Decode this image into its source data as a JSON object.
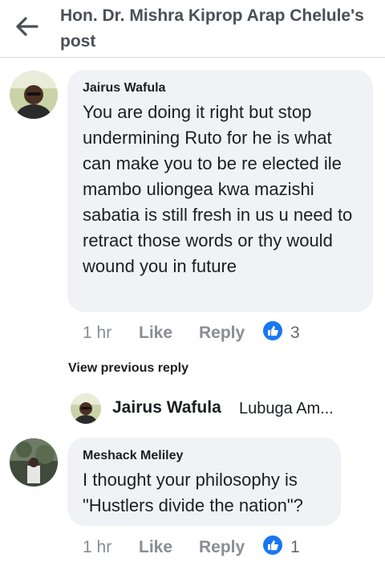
{
  "header": {
    "back_icon": "arrow-left-icon",
    "title": "Hon. Dr. Mishra Kiprop Arap Chelule's post"
  },
  "comments": [
    {
      "author": "Jairus Wafula",
      "text": "You are doing it right but stop undermining Ruto for he is what can make you to be re elected ile mambo uliongea kwa mazishi sabatia is still fresh in us u need to retract those words or thy would wound you in future",
      "time": "1 hr",
      "like_label": "Like",
      "reply_label": "Reply",
      "reaction_icon": "thumbs-up-icon",
      "reaction_count": "3"
    },
    {
      "author": "Meshack Meliley",
      "text": "I thought your philosophy is \"Hustlers divide the nation\"?",
      "time": "1 hr",
      "like_label": "Like",
      "reply_label": "Reply",
      "reaction_icon": "thumbs-up-icon",
      "reaction_count": "1"
    }
  ],
  "view_previous": "View previous reply",
  "reply_preview": {
    "author": "Jairus Wafula",
    "text": "Lubuga Am..."
  },
  "colors": {
    "bubble": "#f0f2f5",
    "like_blue": "#1877f2",
    "muted": "#8a8d91"
  }
}
